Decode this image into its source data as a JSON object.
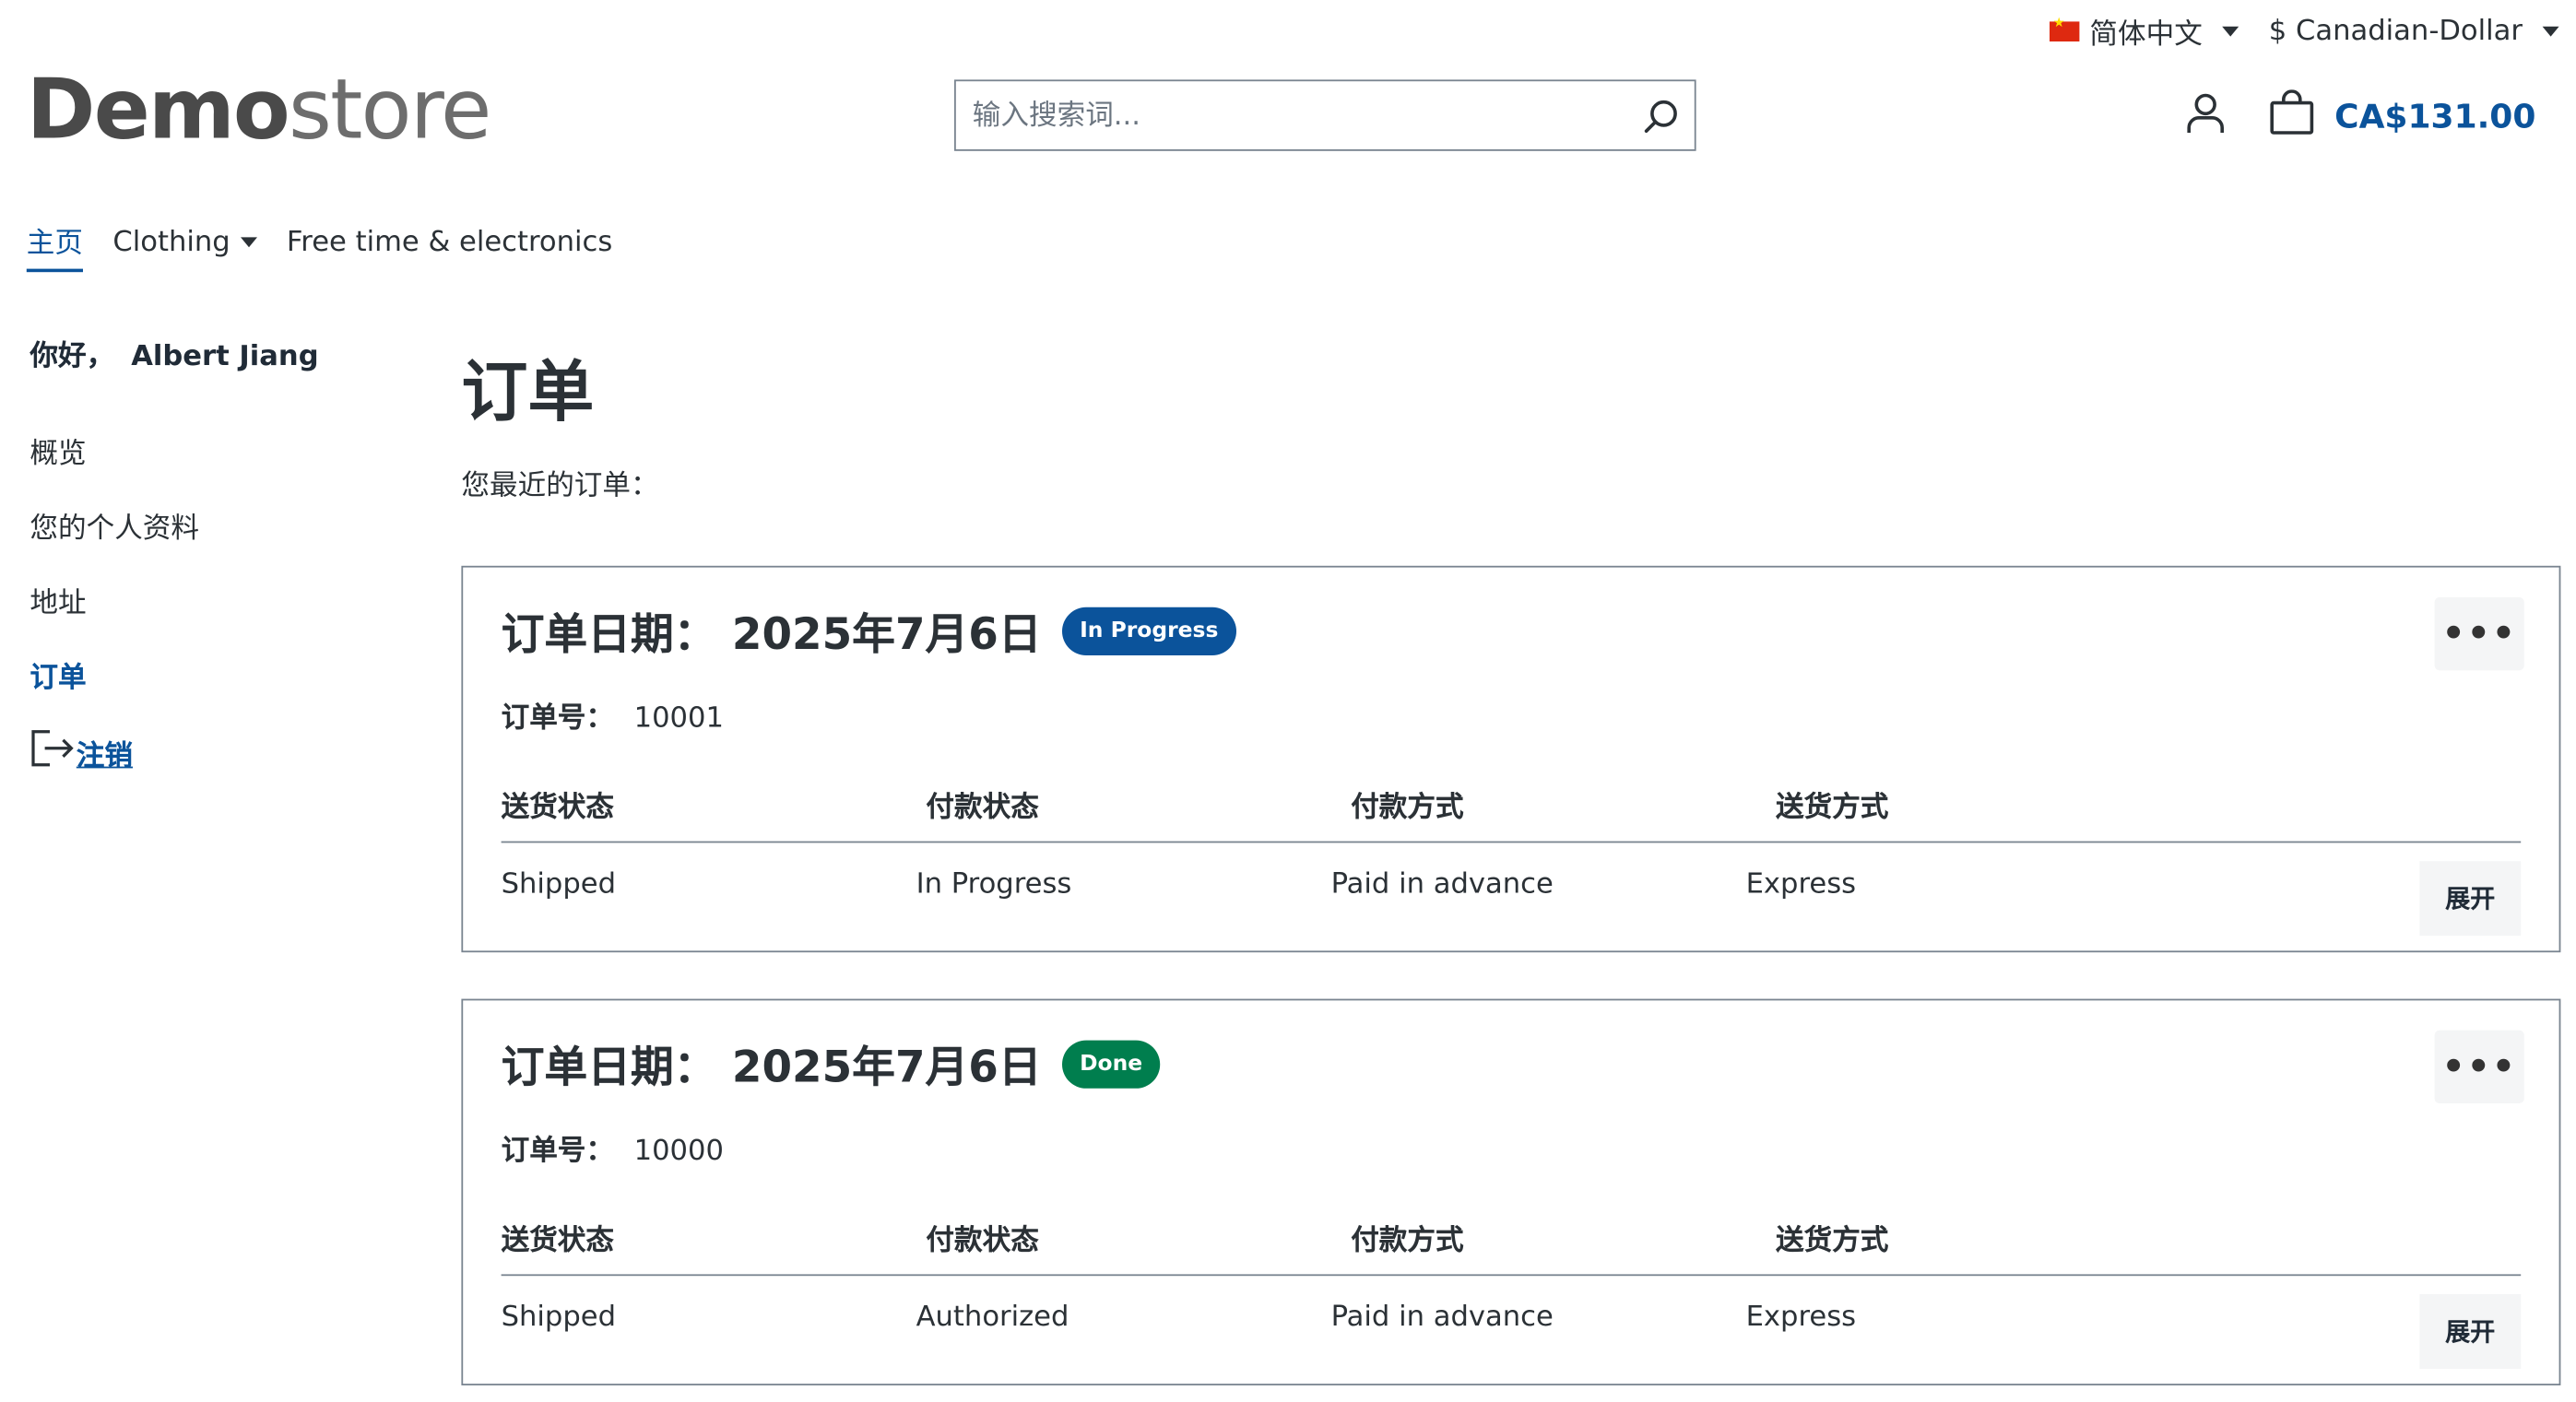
{
  "topbar": {
    "language": "简体中文",
    "currency": "$ Canadian-Dollar"
  },
  "header": {
    "logo_bold": "Demo",
    "logo_light": "store",
    "search_placeholder": "输入搜索词...",
    "cart_total": "CA$131.00"
  },
  "nav": {
    "items": [
      {
        "label": "主页",
        "active": true
      },
      {
        "label": "Clothing",
        "dropdown": true
      },
      {
        "label": "Free time & electronics"
      }
    ]
  },
  "sidebar": {
    "greeting": "你好，",
    "user": "Albert Jiang",
    "items": [
      {
        "label": "概览"
      },
      {
        "label": "您的个人资料"
      },
      {
        "label": "地址"
      },
      {
        "label": "订单",
        "active": true
      }
    ],
    "logout": "注销"
  },
  "main": {
    "title": "订单",
    "subtitle": "您最近的订单：",
    "column_headers": [
      "送货状态",
      "付款状态",
      "付款方式",
      "送货方式"
    ],
    "order_number_label": "订单号：",
    "expand_label": "展开",
    "orders": [
      {
        "date": "订单日期： 2025年7月6日",
        "status_badge": "In Progress",
        "badge_color": "#0b539b",
        "number": "10001",
        "values": [
          "Shipped",
          "In Progress",
          "Paid in advance",
          "Express"
        ]
      },
      {
        "date": "订单日期： 2025年7月6日",
        "status_badge": "Done",
        "badge_color": "#007e4e",
        "number": "10000",
        "values": [
          "Shipped",
          "Authorized",
          "Paid in advance",
          "Express"
        ]
      }
    ]
  }
}
